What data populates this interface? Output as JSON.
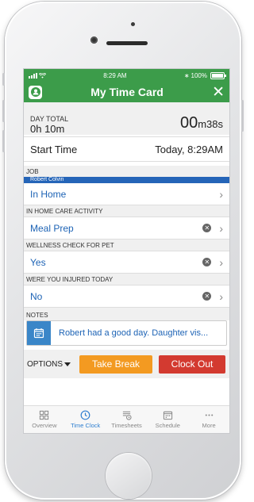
{
  "status_bar": {
    "time": "8:29 AM",
    "battery_pct": "100%"
  },
  "header": {
    "title": "My Time Card"
  },
  "day_total": {
    "label": "DAY TOTAL",
    "value": "0h 10m",
    "elapsed_big": "00",
    "elapsed_small": "m38s"
  },
  "start_time": {
    "label": "Start Time",
    "value": "Today, 8:29AM"
  },
  "job": {
    "label": "JOB",
    "tag": "Robert Colvin",
    "value": "In Home"
  },
  "activity": {
    "label": "IN HOME CARE ACTIVITY",
    "value": "Meal Prep"
  },
  "wellness": {
    "label": "WELLNESS CHECK FOR PET",
    "value": "Yes"
  },
  "injured": {
    "label": "WERE YOU INJURED TODAY",
    "value": "No"
  },
  "notes": {
    "label": "NOTES",
    "value": "Robert had a good day. Daughter vis..."
  },
  "actions": {
    "options_label": "OPTIONS",
    "break_label": "Take Break",
    "clockout_label": "Clock Out"
  },
  "colors": {
    "header_green": "#3c9c4a",
    "link_blue": "#1d63b5",
    "break_orange": "#f39a21",
    "clockout_red": "#d33a30"
  },
  "tabs": [
    {
      "label": "Overview",
      "icon": "overview-grid-icon",
      "active": false
    },
    {
      "label": "Time Clock",
      "icon": "clock-icon",
      "active": true
    },
    {
      "label": "Timesheets",
      "icon": "timesheet-icon",
      "active": false
    },
    {
      "label": "Schedule",
      "icon": "calendar-icon",
      "active": false
    },
    {
      "label": "More",
      "icon": "more-dots-icon",
      "active": false
    }
  ]
}
